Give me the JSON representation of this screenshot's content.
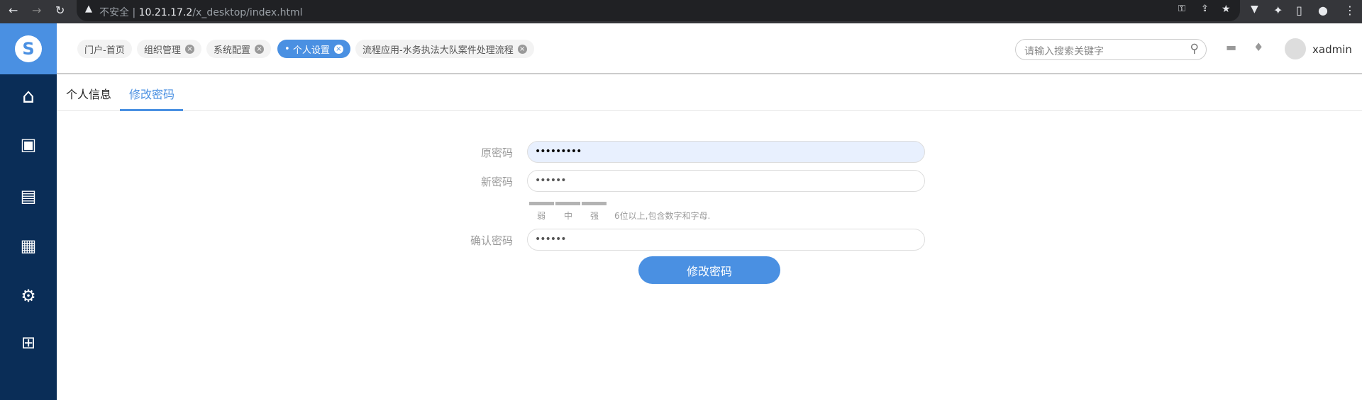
{
  "browser": {
    "insecure": "不安全",
    "host": "10.21.17.2",
    "path": "/x_desktop/index.html"
  },
  "logo": "S",
  "header": {
    "tabs": [
      {
        "label": "门户-首页",
        "closable": false
      },
      {
        "label": "组织管理",
        "closable": true
      },
      {
        "label": "系统配置",
        "closable": true
      },
      {
        "label": "个人设置",
        "closable": true,
        "active": true
      },
      {
        "label": "流程应用-水务执法大队案件处理流程",
        "closable": true
      }
    ],
    "search_placeholder": "请输入搜索关键字",
    "user": "xadmin"
  },
  "page_tabs": [
    "个人信息",
    "修改密码"
  ],
  "form": {
    "old_label": "原密码",
    "old_value": "•••••••••",
    "new_label": "新密码",
    "new_value": "••••••",
    "strength": [
      "弱",
      "中",
      "强"
    ],
    "hint": "6位以上,包含数字和字母.",
    "confirm_label": "确认密码",
    "confirm_value": "••••••",
    "submit": "修改密码"
  },
  "colors": {
    "accent": "#4a90e2",
    "sidebar": "#0a2d57"
  }
}
